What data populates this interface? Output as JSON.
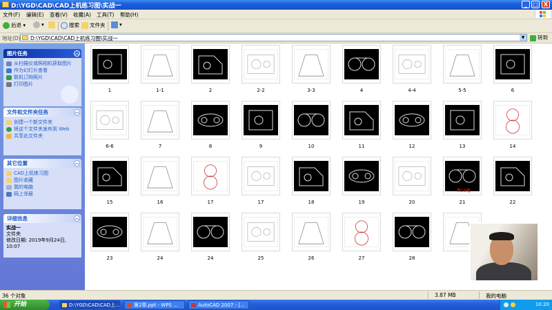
{
  "window": {
    "title": "D:\\YGD\\CAD\\CAD上机练习图\\实战一",
    "controls": {
      "minimize": "_",
      "maximize": "□",
      "close": "X"
    }
  },
  "menu": [
    "文件(F)",
    "编辑(E)",
    "查看(V)",
    "收藏(A)",
    "工具(T)",
    "帮助(H)"
  ],
  "toolbar": {
    "back": "后退",
    "search": "搜索",
    "folders": "文件夹"
  },
  "address": {
    "label": "地址(D)",
    "value": "D:\\YGD\\CAD\\CAD上机练习图\\实战一",
    "go": "转到"
  },
  "sidebar": {
    "picture_tasks": {
      "title": "图片任务",
      "items": [
        "从扫描仪或照相机获取图片",
        "作为幻灯片查看",
        "联机订购照片",
        "打印图片"
      ]
    },
    "file_tasks": {
      "title": "文件和文件夹任务",
      "items": [
        "创建一个新文件夹",
        "将这个文件夹发布到 Web",
        "共享此文件夹"
      ]
    },
    "other_places": {
      "title": "其它位置",
      "items": [
        "CAD上机练习图",
        "图片收藏",
        "我的电脑",
        "网上邻居"
      ]
    },
    "details": {
      "title": "详细信息",
      "name": "实战一",
      "type": "文件夹",
      "modified": "修改日期: 2019年9月24日, 10:07"
    }
  },
  "files": [
    {
      "name": "1",
      "style": "dark"
    },
    {
      "name": "1-1",
      "style": "light"
    },
    {
      "name": "2",
      "style": "dark"
    },
    {
      "name": "2-2",
      "style": "light"
    },
    {
      "name": "3-3",
      "style": "light"
    },
    {
      "name": "4",
      "style": "dark"
    },
    {
      "name": "4-4",
      "style": "light"
    },
    {
      "name": "5-5",
      "style": "light"
    },
    {
      "name": "6",
      "style": "dark"
    },
    {
      "name": "6-6",
      "style": "light"
    },
    {
      "name": "7",
      "style": "light"
    },
    {
      "name": "8",
      "style": "dark"
    },
    {
      "name": "9",
      "style": "dark"
    },
    {
      "name": "10",
      "style": "dark"
    },
    {
      "name": "11",
      "style": "dark"
    },
    {
      "name": "12",
      "style": "dark"
    },
    {
      "name": "13",
      "style": "dark"
    },
    {
      "name": "14",
      "style": "light"
    },
    {
      "name": "15",
      "style": "dark"
    },
    {
      "name": "16",
      "style": "light"
    },
    {
      "name": "17",
      "style": "light"
    },
    {
      "name": "17",
      "style": "light"
    },
    {
      "name": "18",
      "style": "dark"
    },
    {
      "name": "19",
      "style": "dark"
    },
    {
      "name": "20",
      "style": "light"
    },
    {
      "name": "21",
      "style": "dark"
    },
    {
      "name": "22",
      "style": "dark"
    },
    {
      "name": "23",
      "style": "dark"
    },
    {
      "name": "24",
      "style": "light"
    },
    {
      "name": "24",
      "style": "dark"
    },
    {
      "name": "25",
      "style": "light"
    },
    {
      "name": "26",
      "style": "light"
    },
    {
      "name": "27",
      "style": "light"
    },
    {
      "name": "28",
      "style": "dark"
    },
    {
      "name": "",
      "style": "light"
    }
  ],
  "cursor_marker": "第16幅",
  "status": {
    "count": "36 个对象",
    "size": "3.87 MB",
    "location": "我的电脑"
  },
  "taskbar": {
    "start": "开始",
    "tasks": [
      "D:\\YGD\\CAD\\CAD上...",
      "第2章.ppt - WPS ...",
      "AutoCAD 2007 - [..."
    ],
    "clock": "10:20"
  },
  "colors": {
    "xp_blue": "#245edb",
    "sidebar_link": "#215dc6",
    "start_green": "#3c9a37"
  }
}
